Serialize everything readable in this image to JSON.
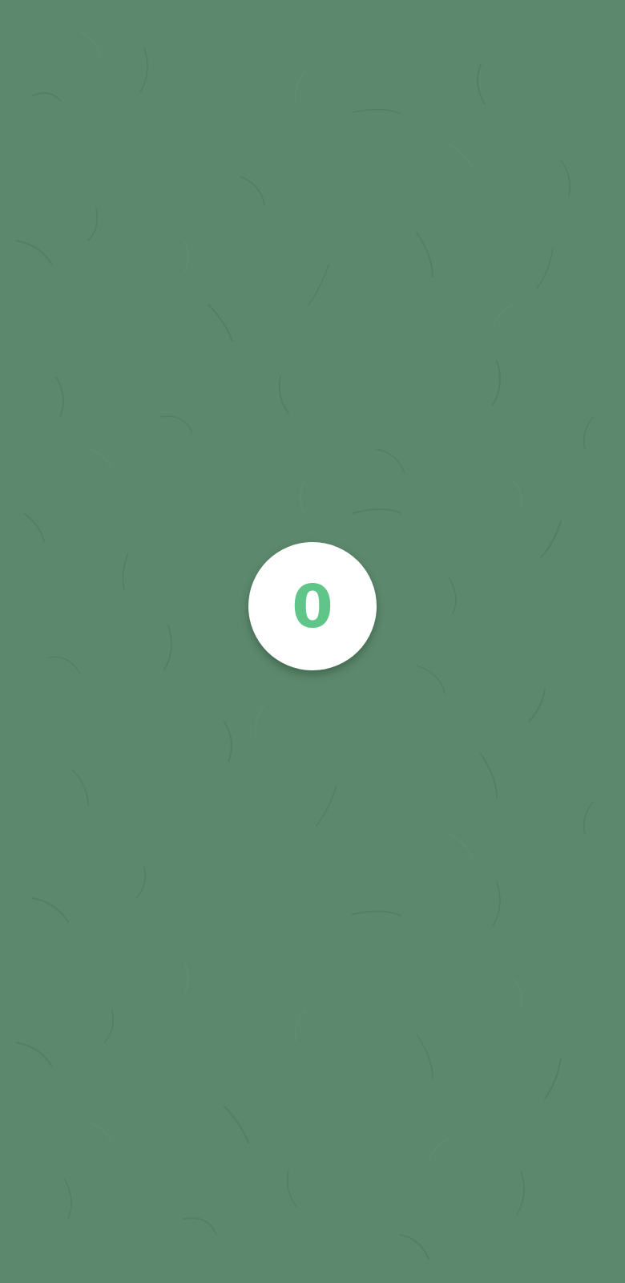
{
  "counter": {
    "value": "0",
    "value_color": "#5fc589"
  },
  "colors": {
    "background": "#5c886d",
    "button": "#ffffff"
  }
}
